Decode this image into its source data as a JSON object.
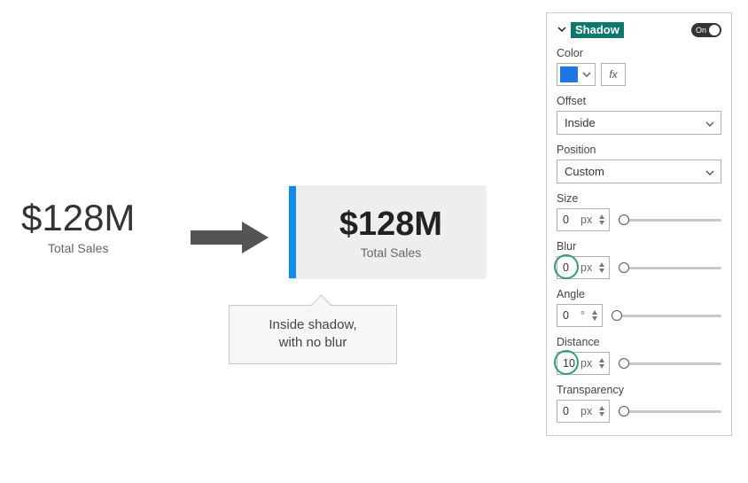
{
  "cards": {
    "plain": {
      "value": "$128M",
      "label": "Total Sales"
    },
    "shadow": {
      "value": "$128M",
      "label": "Total Sales"
    }
  },
  "tooltip": {
    "line1": "Inside shadow,",
    "line2": "with no blur"
  },
  "panel": {
    "section_title": "Shadow",
    "toggle_label": "On",
    "color_label": "Color",
    "color_hex": "#1f77e6",
    "fx_label": "fx",
    "offset_label": "Offset",
    "offset_value": "Inside",
    "position_label": "Position",
    "position_value": "Custom",
    "size": {
      "label": "Size",
      "value": "0",
      "unit": "px"
    },
    "blur": {
      "label": "Blur",
      "value": "0",
      "unit": "px"
    },
    "angle": {
      "label": "Angle",
      "value": "0",
      "unit": "°"
    },
    "distance": {
      "label": "Distance",
      "value": "10",
      "unit": "px"
    },
    "transparency": {
      "label": "Transparency",
      "value": "0",
      "unit": "px"
    }
  }
}
